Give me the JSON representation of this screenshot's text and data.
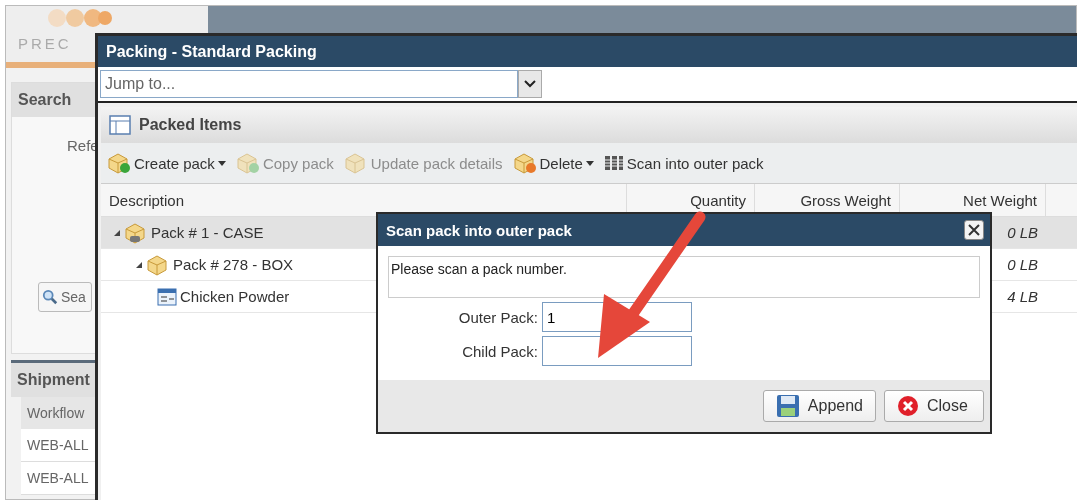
{
  "background": {
    "logo": "PREC",
    "search_panel": {
      "title": "Search",
      "label": "Refe",
      "search_button": "Sea"
    },
    "shipments": {
      "title": "Shipment",
      "column": "Workflow",
      "rows": [
        "WEB-ALL",
        "WEB-ALL"
      ]
    }
  },
  "window": {
    "title": "Packing - Standard Packing",
    "jump": {
      "placeholder": "Jump to..."
    },
    "panel": {
      "title": "Packed Items",
      "toolbar": [
        {
          "label": "Create pack",
          "kind": "create",
          "disabled": false,
          "dropdown": true
        },
        {
          "label": "Copy pack",
          "kind": "copy",
          "disabled": true,
          "dropdown": false
        },
        {
          "label": "Update pack details",
          "kind": "update",
          "disabled": true,
          "dropdown": false
        },
        {
          "label": "Delete",
          "kind": "delete",
          "disabled": false,
          "dropdown": true
        },
        {
          "label": "Scan into outer pack",
          "kind": "scan",
          "disabled": false,
          "dropdown": false
        }
      ],
      "columns": [
        "Description",
        "Quantity",
        "Gross Weight",
        "Net Weight"
      ],
      "rows": [
        {
          "label": "Pack # 1 - CASE",
          "kind": "case",
          "expanded": true,
          "selected": true,
          "net_weight": "0 LB",
          "children": [
            {
              "label": "Pack # 278 - BOX",
              "kind": "box",
              "expanded": true,
              "selected": false,
              "net_weight": "0 LB",
              "children": [
                {
                  "label": "Chicken Powder",
                  "kind": "item",
                  "selected": false,
                  "net_weight": "4 LB"
                }
              ]
            }
          ]
        }
      ]
    }
  },
  "dialog": {
    "title": "Scan pack into outer pack",
    "message": "Please scan a pack number.",
    "fields": [
      {
        "label": "Outer Pack:",
        "value": "1"
      },
      {
        "label": "Child Pack:"
      }
    ],
    "buttons": [
      {
        "label": "Append",
        "kind": "save"
      },
      {
        "label": "Close",
        "kind": "close"
      }
    ]
  }
}
